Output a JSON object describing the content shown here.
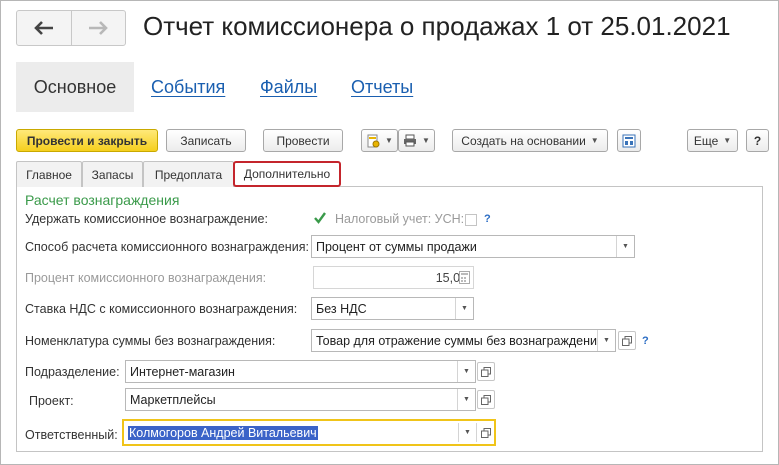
{
  "nav": {
    "back_icon": "arrow-left",
    "forward_icon": "arrow-right"
  },
  "title": "Отчет комиссионера о продажах 1 от 25.01.2021",
  "sections": {
    "main": "Основное",
    "events": "События",
    "files": "Файлы",
    "reports": "Отчеты"
  },
  "toolbar": {
    "post_close": "Провести и закрыть",
    "save": "Записать",
    "post": "Провести",
    "create_based": "Создать на основании",
    "more": "Еще",
    "help": "?"
  },
  "tabs": [
    "Главное",
    "Запасы",
    "Предоплата",
    "Дополнительно"
  ],
  "active_tab": "Дополнительно",
  "group": {
    "title": "Расчет вознаграждения",
    "withhold_label": "Удержать комиссионное вознаграждение:",
    "withhold_checked": true,
    "tax_label": "Налоговый учет: УСН:",
    "tax_checked": false,
    "help_mark": "?",
    "method_label": "Способ расчета комиссионного вознаграждения:",
    "method_value": "Процент от суммы продажи",
    "percent_label": "Процент комиссионного вознаграждения:",
    "percent_value": "15,00",
    "vat_label": "Ставка НДС с комиссионного вознаграждения:",
    "vat_value": "Без НДС",
    "nomenclature_label": "Номенклатура суммы без вознаграждения:",
    "nomenclature_value": "Товар для отражение суммы без вознаграждения",
    "department_label": "Подразделение:",
    "department_value": "Интернет-магазин",
    "project_label": "Проект:",
    "project_value": "Маркетплейсы",
    "responsible_label": "Ответственный:",
    "responsible_value": "Колмогоров Андрей Витальевич"
  },
  "colors": {
    "accent_link": "#1a5fb0",
    "primary_button": "#f5cf1e",
    "group_title": "#3a9a4a",
    "active_tab_border": "#c4252c",
    "focus_border": "#f0c419",
    "selection": "#3b63c8"
  }
}
